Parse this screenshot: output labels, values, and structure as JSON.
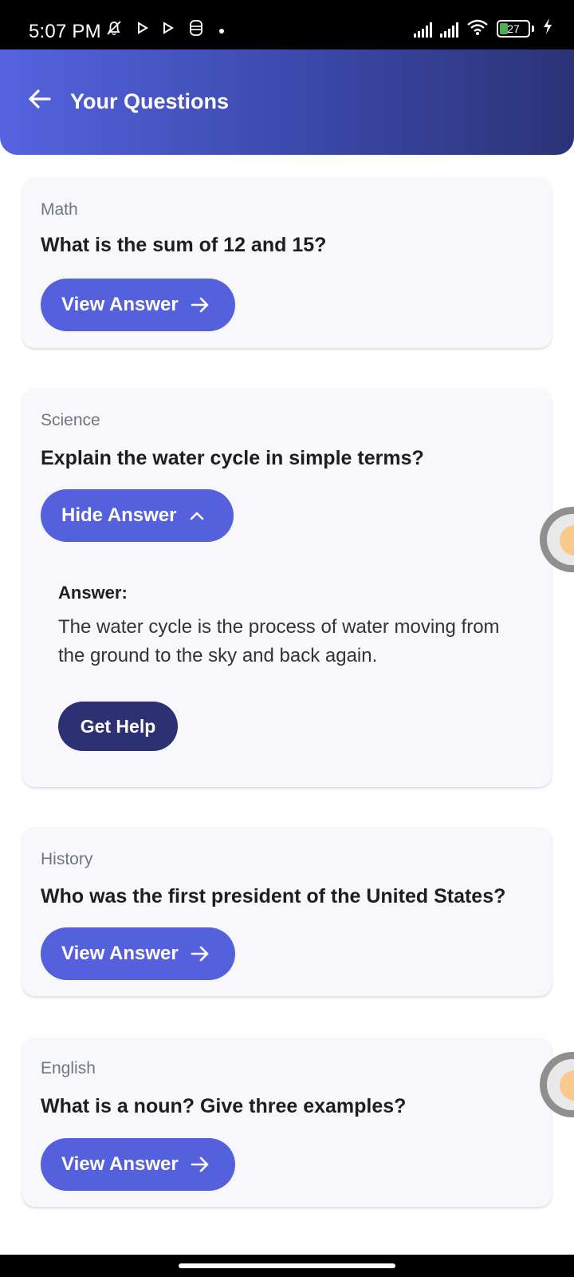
{
  "status_bar": {
    "time": "5:07 PM",
    "icons": [
      "muted-bell-icon",
      "play-icon",
      "play-icon",
      "notification-icon",
      "dot-icon"
    ],
    "battery": "27",
    "right_icons": [
      "signal-icon",
      "signal-icon",
      "wifi-icon",
      "battery-icon",
      "charging-icon"
    ]
  },
  "header": {
    "title": "Your Questions",
    "back_icon": "arrow-left-icon"
  },
  "questions": [
    {
      "subject": "Math",
      "question": "What is the sum of 12 and 15?",
      "button_label": "View Answer",
      "button_icon": "arrow-right-icon",
      "expanded": false
    },
    {
      "subject": "Science",
      "question": "Explain the water cycle in simple terms?",
      "button_label": "Hide Answer",
      "button_icon": "chevron-up-icon",
      "expanded": true,
      "answer_label": "Answer:",
      "answer_text": "The water cycle is the process of water moving from the ground to the sky and back again.",
      "help_label": "Get Help"
    },
    {
      "subject": "History",
      "question": "Who was the first president of the United States?",
      "button_label": "View Answer",
      "button_icon": "arrow-right-icon",
      "expanded": false
    },
    {
      "subject": "English",
      "question": "What is a noun? Give three examples?",
      "button_label": "View Answer",
      "button_icon": "arrow-right-icon",
      "expanded": false
    }
  ],
  "colors": {
    "header_start": "#5563e0",
    "header_end": "#2b3377",
    "primary_button": "#5560dd",
    "help_button": "#2c3173",
    "card_bg": "#f8f8fc"
  }
}
